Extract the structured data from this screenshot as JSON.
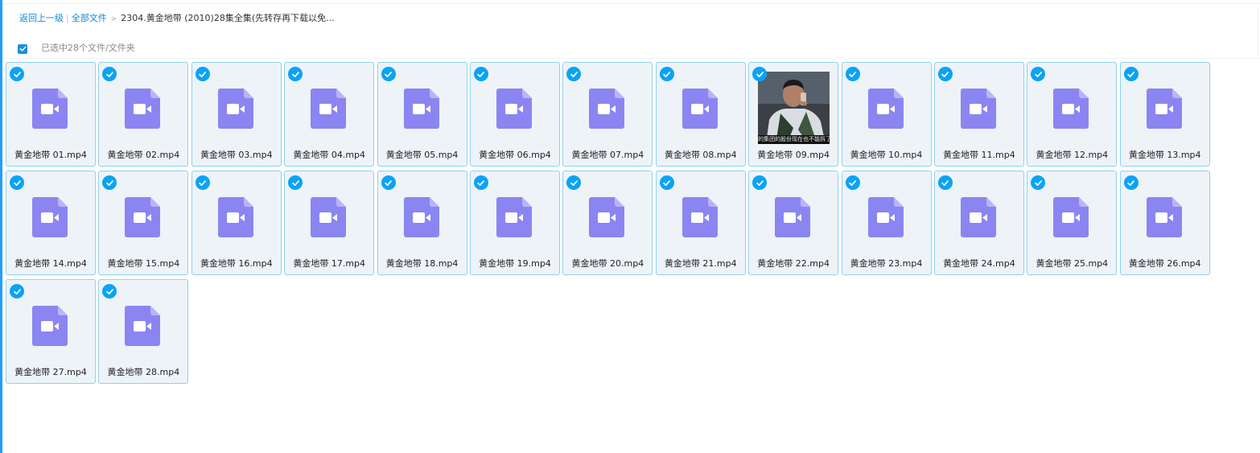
{
  "breadcrumb": {
    "back": "返回上一级",
    "separator": "|",
    "all_files": "全部文件",
    "arrow": ">",
    "current": "2304.黄金地带 (2010)28集全集(先转存再下载以免..."
  },
  "selection": {
    "count_text": "已选中28个文件/文件夹"
  },
  "colors": {
    "accent": "#0aa3f5",
    "video_icon": "#8b85f2",
    "tile_bg": "#eef3f8",
    "tile_border": "#8fd0ef"
  },
  "thumbnail_subtitle": "的集团的股份现在也不能拆了",
  "files": [
    {
      "name": "黄金地带 01.mp4",
      "icon": "video-file-icon"
    },
    {
      "name": "黄金地带 02.mp4",
      "icon": "video-file-icon"
    },
    {
      "name": "黄金地带 03.mp4",
      "icon": "video-file-icon"
    },
    {
      "name": "黄金地带 04.mp4",
      "icon": "video-file-icon"
    },
    {
      "name": "黄金地带 05.mp4",
      "icon": "video-file-icon"
    },
    {
      "name": "黄金地带 06.mp4",
      "icon": "video-file-icon"
    },
    {
      "name": "黄金地带 07.mp4",
      "icon": "video-file-icon"
    },
    {
      "name": "黄金地带 08.mp4",
      "icon": "video-file-icon"
    },
    {
      "name": "黄金地带 09.mp4",
      "icon": "video-thumbnail"
    },
    {
      "name": "黄金地带 10.mp4",
      "icon": "video-file-icon"
    },
    {
      "name": "黄金地带 11.mp4",
      "icon": "video-file-icon"
    },
    {
      "name": "黄金地带 12.mp4",
      "icon": "video-file-icon"
    },
    {
      "name": "黄金地带 13.mp4",
      "icon": "video-file-icon"
    },
    {
      "name": "黄金地带 14.mp4",
      "icon": "video-file-icon"
    },
    {
      "name": "黄金地带 15.mp4",
      "icon": "video-file-icon"
    },
    {
      "name": "黄金地带 16.mp4",
      "icon": "video-file-icon"
    },
    {
      "name": "黄金地带 17.mp4",
      "icon": "video-file-icon"
    },
    {
      "name": "黄金地带 18.mp4",
      "icon": "video-file-icon"
    },
    {
      "name": "黄金地带 19.mp4",
      "icon": "video-file-icon"
    },
    {
      "name": "黄金地带 20.mp4",
      "icon": "video-file-icon"
    },
    {
      "name": "黄金地带 21.mp4",
      "icon": "video-file-icon"
    },
    {
      "name": "黄金地带 22.mp4",
      "icon": "video-file-icon"
    },
    {
      "name": "黄金地带 23.mp4",
      "icon": "video-file-icon"
    },
    {
      "name": "黄金地带 24.mp4",
      "icon": "video-file-icon"
    },
    {
      "name": "黄金地带 25.mp4",
      "icon": "video-file-icon"
    },
    {
      "name": "黄金地带 26.mp4",
      "icon": "video-file-icon"
    },
    {
      "name": "黄金地带 27.mp4",
      "icon": "video-file-icon"
    },
    {
      "name": "黄金地带 28.mp4",
      "icon": "video-file-icon"
    }
  ]
}
